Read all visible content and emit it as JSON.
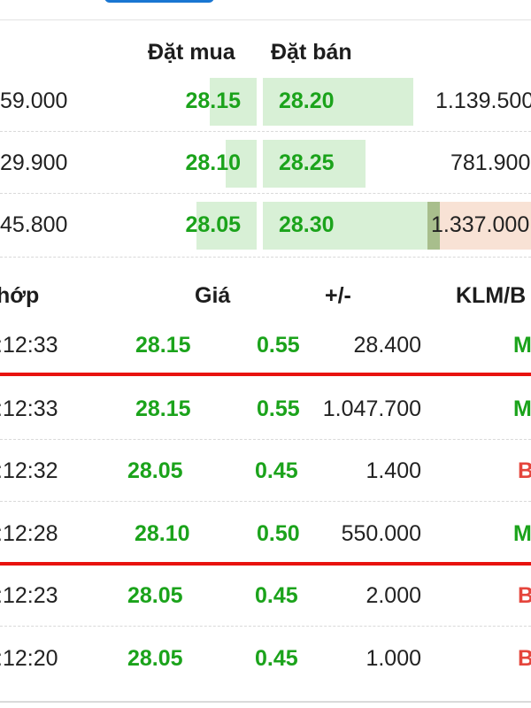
{
  "orderbook": {
    "headers": {
      "bid": "Đặt mua",
      "ask": "Đặt bán"
    },
    "rows": [
      {
        "bid_volume": "59.000",
        "bid_price": "28.15",
        "ask_price": "28.20",
        "ask_volume": "1.139.500"
      },
      {
        "bid_volume": "29.900",
        "bid_price": "28.10",
        "ask_price": "28.25",
        "ask_volume": "781.900"
      },
      {
        "bid_volume": "45.800",
        "bid_price": "28.05",
        "ask_price": "28.30",
        "ask_volume": "1.337.000"
      }
    ]
  },
  "trades": {
    "headers": {
      "time": "hớp",
      "price": "Giá",
      "change": "+/-",
      "volume_side": "KLM/B"
    },
    "rows": [
      {
        "time": ":12:33",
        "price": "28.15",
        "change": "0.55",
        "volume": "28.400",
        "side": "M",
        "side_color": "#1ba31b"
      },
      {
        "time": ":12:33",
        "price": "28.15",
        "change": "0.55",
        "volume": "1.047.700",
        "side": "M",
        "side_color": "#1ba31b"
      },
      {
        "time": ":12:32",
        "price": "28.05",
        "change": "0.45",
        "volume": "1.400",
        "side": "B",
        "side_color": "#e5453c"
      },
      {
        "time": ":12:28",
        "price": "28.10",
        "change": "0.50",
        "volume": "550.000",
        "side": "M",
        "side_color": "#1ba31b"
      },
      {
        "time": ":12:23",
        "price": "28.05",
        "change": "0.45",
        "volume": "2.000",
        "side": "B",
        "side_color": "#e5453c"
      },
      {
        "time": ":12:20",
        "price": "28.05",
        "change": "0.45",
        "volume": "1.000",
        "side": "B",
        "side_color": "#e5453c"
      }
    ]
  },
  "colors": {
    "up_green": "#1ba31b",
    "down_red": "#e5453c",
    "highlight_line": "#e8120e",
    "bar_green": "#d8f0d6",
    "bar_orange": "#f8e2d5"
  }
}
